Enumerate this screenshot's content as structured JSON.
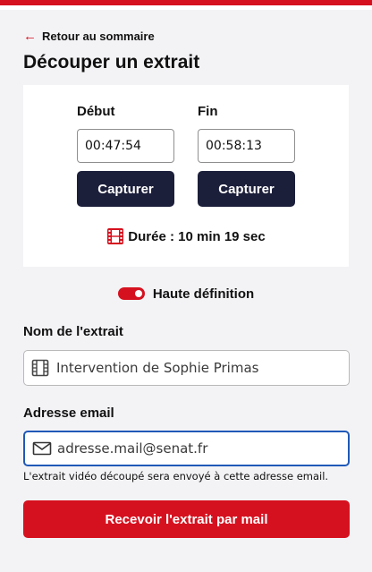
{
  "nav": {
    "back_arrow": "←",
    "back_label": "Retour au sommaire"
  },
  "page": {
    "title": "Découper un extrait"
  },
  "clip": {
    "start_label": "Début",
    "start_value": "00:47:54",
    "end_label": "Fin",
    "end_value": "00:58:13",
    "capture_label": "Capturer",
    "duration_text": "Durée : 10 min 19 sec"
  },
  "hd": {
    "label": "Haute définition",
    "enabled": true
  },
  "form": {
    "name_label": "Nom de l'extrait",
    "name_value": "Intervention de Sophie Primas",
    "email_label": "Adresse email",
    "email_value": "adresse.mail@senat.fr",
    "help_text": "L'extrait vidéo découpé sera envoyé à cette adresse email.",
    "submit_label": "Recevoir l'extrait par mail"
  },
  "icons": {
    "back": "arrow-left-icon",
    "duration": "film-icon",
    "name_field": "film-icon",
    "email_field": "envelope-icon"
  },
  "colors": {
    "accent": "#d6111f",
    "button_dark": "#1c1f3a",
    "focus_border": "#1f59b8",
    "background": "#f3f3f6"
  }
}
